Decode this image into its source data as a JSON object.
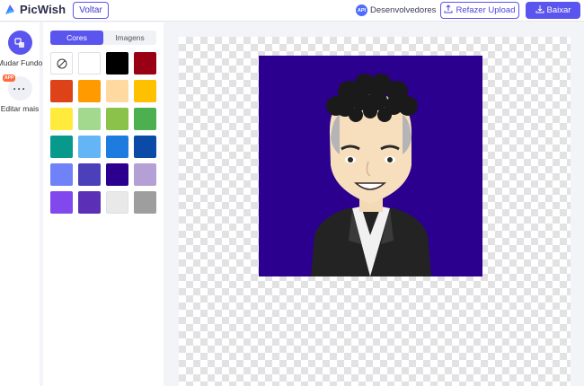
{
  "header": {
    "brand": "PicWish",
    "back_label": "Voltar",
    "developers_label": "Desenvolvedores",
    "api_badge": "API",
    "reupload_label": "Refazer Upload",
    "download_label": "Baixar"
  },
  "rail": {
    "items": [
      {
        "label": "Mudar Fundo"
      },
      {
        "label": "Editar mais",
        "tag": "APP"
      }
    ]
  },
  "panel": {
    "tabs": [
      {
        "label": "Cores",
        "active": true
      },
      {
        "label": "Imagens",
        "active": false
      }
    ],
    "swatches": [
      "none",
      "#ffffff",
      "#000000",
      "#9a0013",
      "#dd4219",
      "#ff9a00",
      "#ffd9a0",
      "#ffc000",
      "#ffeb3b",
      "#a3d88f",
      "#8bc34a",
      "#4caf50",
      "#079a8c",
      "#64b5f6",
      "#1e7be0",
      "#0b4aa6",
      "#6f82f7",
      "#4b3fba",
      "#2b008f",
      "#b4a0d4",
      "#8148ee",
      "#5b2fb6",
      "#e9e9e9",
      "#9e9e9e"
    ],
    "selected_color": "#2b008f"
  }
}
